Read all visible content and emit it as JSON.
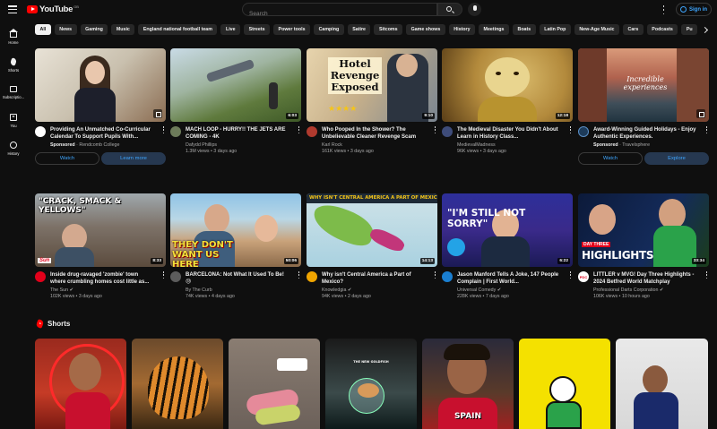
{
  "header": {
    "logo_text": "YouTube",
    "logo_region": "GB",
    "search_placeholder": "Search",
    "signin_label": "Sign in"
  },
  "sidenav": [
    {
      "label": "Home",
      "icon": "home-icon"
    },
    {
      "label": "Shorts",
      "icon": "shorts-icon"
    },
    {
      "label": "Subscriptio...",
      "icon": "subscriptions-icon"
    },
    {
      "label": "You",
      "icon": "you-icon"
    },
    {
      "label": "History",
      "icon": "history-icon"
    }
  ],
  "chips": [
    "All",
    "News",
    "Gaming",
    "Music",
    "England national football team",
    "Live",
    "Streets",
    "Power tools",
    "Camping",
    "Satire",
    "Sitcoms",
    "Game shows",
    "History",
    "Meetings",
    "Boats",
    "Latin Pop",
    "New-Age Music",
    "Cars",
    "Podcasts",
    "Pu"
  ],
  "videos": [
    {
      "title": "Providing An Unmatched Co-Curricular Calendar To Support Pupils With...",
      "channel": "Rendcomb College",
      "sponsored_label": "Sponsored",
      "stats": "",
      "duration": "",
      "overlay": "",
      "ad_buttons": [
        "Watch",
        "Learn more"
      ]
    },
    {
      "title": "MACH LOOP - HURRY!! THE JETS ARE COMING - 4K",
      "channel": "Dafydd Phillips",
      "stats": "1.3M views • 3 days ago",
      "duration": "6:03",
      "overlay": ""
    },
    {
      "title": "Who Pooped In the Shower? The Unbelievable Cleaner Revenge Scam",
      "channel": "Karl Rock",
      "stats": "161K views • 3 days ago",
      "duration": "9:10",
      "overlay": "Hotel Revenge Exposed"
    },
    {
      "title": "The Medieval Disaster You Didn't About Learn in History Class...",
      "channel": "MedievalMadness",
      "stats": "96K views • 3 days ago",
      "duration": "12:18",
      "overlay": ""
    },
    {
      "title": "Award-Winning Guided Holidays - Enjoy Authentic Experiences.",
      "channel": "Travelsphere",
      "sponsored_label": "Sponsored",
      "stats": "",
      "duration": "",
      "overlay": "Incredible experiences",
      "ad_buttons": [
        "Watch",
        "Explore"
      ]
    },
    {
      "title": "Inside drug-ravaged 'zombie' town where crumbling homes cost little as...",
      "channel": "The Sun",
      "stats": "102K views • 3 days ago",
      "duration": "8:33",
      "overlay": "\"CRACK, SMACK & YELLOWS\""
    },
    {
      "title": "BARCELONA: Not What It Used To Be! 😓",
      "channel": "By The Curb",
      "stats": "74K views • 4 days ago",
      "duration": "50:06",
      "overlay": "THEY DON'T WANT US HERE"
    },
    {
      "title": "Why isn't Central America a Part of Mexico?",
      "channel": "Knowledgia",
      "stats": "94K views • 2 days ago",
      "duration": "14:13",
      "overlay": "WHY ISN'T CENTRAL AMERICA A PART OF MEXICO?"
    },
    {
      "title": "Jason Manford Tells A Joke, 147 People Complain | First World...",
      "channel": "Universal Comedy",
      "stats": "228K views • 7 days ago",
      "duration": "6:22",
      "overlay": "\"I'M STILL NOT SORRY\""
    },
    {
      "title": "LITTLER v MVG! Day Three Highlights - 2024 Betfred World Matchplay",
      "channel": "Professional Darts Corporation",
      "stats": "106K views • 10 hours ago",
      "duration": "33:34",
      "overlay": "DAY THREE HIGHLIGHTS"
    }
  ],
  "shorts": {
    "title": "Shorts",
    "items": [
      {
        "overlay": ""
      },
      {
        "overlay": ""
      },
      {
        "overlay": ""
      },
      {
        "overlay": "THE NEW GOLDFISH"
      },
      {
        "overlay": "SPAIN"
      },
      {
        "overlay": ""
      },
      {
        "overlay": ""
      }
    ]
  },
  "colors": {
    "background": "#0f0f0f",
    "accent_blue": "#3ea6ff",
    "brand_red": "#ff0000",
    "chip_bg": "#272727"
  }
}
